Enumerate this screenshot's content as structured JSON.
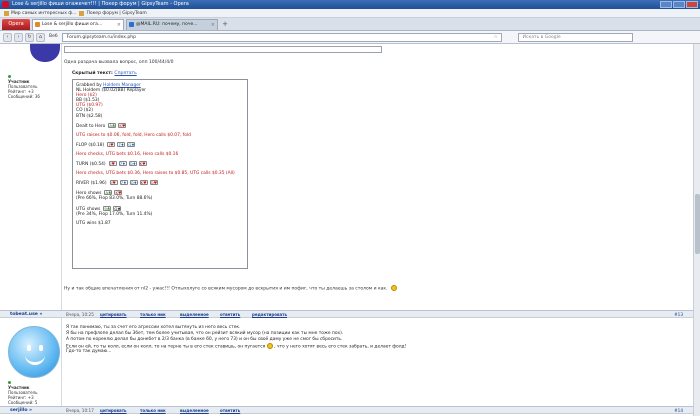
{
  "window": {
    "title": "Lose & serjillo фиши огажечет!!! | Покер форум | GipsyTeam - Opera"
  },
  "bookmarks": [
    {
      "label": "Мир самых интересных ф..."
    },
    {
      "label": "Покер форум | GipsyTeam"
    }
  ],
  "tabs": {
    "opera_label": "Opera",
    "items": [
      {
        "label": "Lose & serjillo фиши ога..."
      },
      {
        "label": "@MAIL.RU: почему, поче..."
      }
    ]
  },
  "address": {
    "web_label": "Веб",
    "url": "Forum.gipsyteam.ru/index.php",
    "search_placeholder": "Искать в Google"
  },
  "post1": {
    "author_profile": {
      "role": "Участник",
      "group": "Пользователь",
      "rating": "Рейтинг: +3",
      "posts": "Сообщений: 36"
    },
    "question": "Одна раздача вызвала вопрос, опп 100/44/4/0",
    "hidden_label": "Скрытый текст:",
    "hide_link": "Спрятать",
    "hand": {
      "l1": "Grabbed by Holdem Manager",
      "l1_link": "Holdem Manager",
      "l2": "NL Holdem ($0.02(BB) Replayer",
      "l3": "Hero ($2)",
      "l4": "BB ($1.53)",
      "l5": "UTG ($0.97)",
      "l6": "CO ($2)",
      "l7": "BTN ($2.58)",
      "dealt": "Dealt to Hero",
      "preflop": "UTG raises to $0.06, fold, fold, Hero calls $0.07, fold",
      "flop": "FLOP ($0.18)",
      "flop_action": "Hero checks, UTG bets $0.16, Hero calls $0.16",
      "turn": "TURN ($0.54)",
      "turn_action": "Hero checks, UTG bets $0.36, Hero raises to $0.85, UTG calls $0.35 (All)",
      "river": "RIVER ($1.96)",
      "hero_shows": "Hero shows",
      "hero_eq": "(Pre 66%, Flop 83.0%, Turn 88.6%)",
      "utg_shows": "UTG shows",
      "utg_eq": "(Pre 34%, Flop 17.0%, Turn 11.4%)",
      "utg_wins": "UTG wins $1.87"
    },
    "closing": "Ну и так общие впечатления от nl2 - ужас!!! Отлыхолуге со всяким мусором до вскрытия и им пофиг, что ты делаешь за столом и как."
  },
  "post2": {
    "author": "tobeat.use »",
    "date": "Вчера, 10:25",
    "buttons": {
      "quote": "цитировать",
      "only_me": "только ник",
      "selected": "выделенное",
      "reply": "ответить",
      "edit": "редактировать"
    },
    "number": "#13",
    "lines": [
      "Я так понимаю, ты за счет его агрессии хотел вытянуть из него весь стек.",
      "Я бы на префлопе делал бы 3бет, тем более учитывая, что он рейзит всякий мусор (на позиции как ты мне тоже пох).",
      "А потом по кореелю делал бы донкбет в 2/3 банка (в банке 60, у него 73) и он бы своё даму уже не смог бы сбросить.",
      "Если он ей, то ты колл, если он колл, то на терне ты в его стек ставишь, он пугается",
      ", что у него хотят весь его стек забрать, и делает фолд!",
      "Гдо-то так думаю..."
    ],
    "author_profile": {
      "role": "Участник",
      "group": "Пользователь",
      "rating": "Рейтинг: +3",
      "posts": "Сообщений: 5"
    }
  },
  "post3": {
    "author": "serjillo »",
    "date": "Вчера, 10:17",
    "number": "#14"
  },
  "colors": {
    "accent": "#1b3f8b",
    "red": "#c0191b"
  }
}
